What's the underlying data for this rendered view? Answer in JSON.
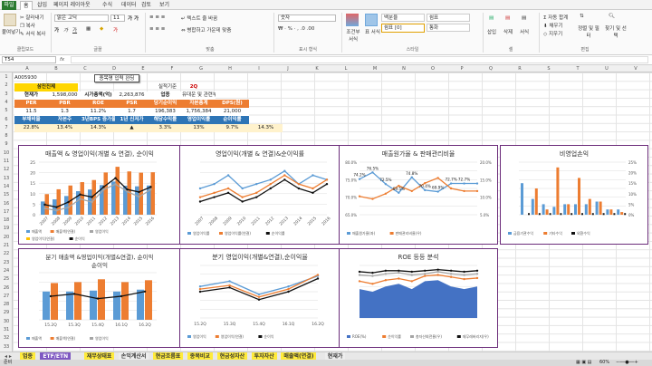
{
  "menu": {
    "file": "파일",
    "tabs": [
      "홈",
      "삽입",
      "페이지 레이아웃",
      "수식",
      "데이터",
      "검토",
      "보기"
    ]
  },
  "ribbon": {
    "paste": "붙여넣기",
    "cut": "잘라내기",
    "copy": "복사",
    "format_painter": "서식 복사",
    "font": "맑은 고딕",
    "font_size": "11",
    "wrap_text": "텍스트 줄 바꿈",
    "merge": "병합하고 가운데 맞춤",
    "number_format": "숫자",
    "style_bad": "백분율",
    "style_good": "쉼표",
    "style_sel": "쉼표 [0]",
    "style_currency": "통화",
    "cond_format": "조건부 서식",
    "table_format": "표 서식",
    "cell_style": "셀 스타일",
    "insert": "삽입",
    "delete": "삭제",
    "format": "서식",
    "autosum": "자동 합계",
    "fill": "채우기",
    "clear": "지우기",
    "sort": "정렬 및 필터",
    "find": "찾기 및 선택",
    "groups": [
      "클립보드",
      "글꼴",
      "맞춤",
      "표시 형식",
      "스타일",
      "셀",
      "편집"
    ]
  },
  "formula_bar": {
    "name_box": "T54",
    "fx": "fx",
    "content": ""
  },
  "columns": [
    "A",
    "B",
    "C",
    "D",
    "E",
    "F",
    "G",
    "H",
    "I",
    "J",
    "K",
    "L",
    "M",
    "N",
    "O",
    "P",
    "Q",
    "R",
    "S",
    "T",
    "U",
    "V"
  ],
  "rows": [
    "1",
    "2",
    "3",
    "4",
    "5",
    "6",
    "7",
    "8",
    "9",
    "10",
    "11",
    "12",
    "13",
    "14",
    "15",
    "16",
    "17",
    "18",
    "19",
    "20",
    "21",
    "22",
    "23",
    "24",
    "25",
    "26",
    "27",
    "28",
    "29",
    "30",
    "31",
    "32",
    "33"
  ],
  "sheet": {
    "code": "A005930",
    "button": "종목명 입력 완딩",
    "company": "삼진진제",
    "period_label": "실적기준",
    "period": "2Q",
    "row3": [
      "현재가",
      "1,598,000",
      "시가총액(억)",
      "2,263,876",
      "업종",
      "유대운 및 관련부품"
    ],
    "row4": [
      "PER",
      "PBR",
      "ROE",
      "PSR",
      "당기순이익",
      "자본총계",
      "DPS(원)"
    ],
    "row5": [
      "11.5",
      "1.3",
      "11.2%",
      "1.7",
      "196,383",
      "1,756,384",
      "21,000"
    ],
    "row6": [
      "부채비율",
      "자본주",
      "3년BPS 증가율",
      "1년 신저가",
      "해당수익률",
      "영업이익률",
      "순이익률"
    ],
    "row7": [
      "22.8%",
      "13.4%",
      "14.3%",
      "▲",
      "3.3%",
      "13%",
      "9.7%",
      "14.3%"
    ]
  },
  "charts": {
    "c1": {
      "title": "매출액 & 영업이익(개별 & 연결), 순이익",
      "legend": [
        "매출액",
        "매출액(연결)",
        "영업이익",
        "영업이익(연결)",
        "순이익"
      ]
    },
    "c2": {
      "title": "영업이익(개별 & 연결)&순이익률",
      "legend": [
        "영업이익률",
        "영업이익률(연결)",
        "순이익률"
      ]
    },
    "c3": {
      "title": "매출원가율 & 판매관리비율",
      "legend": [
        "매출원가율(좌)",
        "판매관리비율(우)"
      ],
      "labels": [
        "74.2%",
        "76.5%",
        "72.5%",
        "69.5%",
        "74.8%",
        "70.4%",
        "69.9%",
        "72.7%",
        "72.7%"
      ]
    },
    "c4": {
      "title": "비영업손익",
      "legend": [
        "금융기관수익",
        "기타수익",
        "외환수익"
      ]
    },
    "c5": {
      "title": "분기 매출액 &영업이익(개별&연결), 순이익",
      "legend": [
        "매출액",
        "매출액(연결)",
        "영업이익"
      ]
    },
    "c6": {
      "title": "분기 영업이익(개별&연결),순이익율",
      "legend": [
        "영업이익",
        "영업이익(연결)",
        "순이익"
      ]
    },
    "c7": {
      "title": "ROE 등등 분석",
      "legend": [
        "ROE(%)",
        "순이익률",
        "총자산회전율(우)",
        "재무레버리지(우)"
      ]
    }
  },
  "chart_data": [
    {
      "type": "bar",
      "title": "매출액 & 영업이익(개별 & 연결), 순이익",
      "categories": [
        "2007",
        "2008",
        "2009",
        "2010",
        "2011",
        "2012",
        "2013",
        "2014",
        "2015",
        "2016"
      ],
      "series": [
        {
          "name": "매출액",
          "values": [
            6.3,
            7.3,
            8.9,
            11.2,
            12.0,
            14.1,
            15.8,
            13.8,
            13.5,
            13.9
          ]
        },
        {
          "name": "매출액(연결)",
          "values": [
            9.8,
            12.1,
            13.9,
            15.5,
            16.5,
            20.1,
            22.8,
            20.6,
            20.0,
            20.2
          ]
        },
        {
          "name": "영업이익",
          "values": [
            0.6,
            0.4,
            0.7,
            1.5,
            1.2,
            2.4,
            2.9,
            2.2,
            1.7,
            2.4
          ]
        },
        {
          "name": "순이익",
          "values": [
            0.8,
            0.6,
            1.0,
            1.6,
            1.4,
            2.2,
            2.9,
            2.0,
            1.8,
            2.2
          ]
        }
      ],
      "ylim": [
        0,
        25
      ]
    },
    {
      "type": "line",
      "title": "매출원가율 & 판매관리비율",
      "categories": [
        "2007",
        "2008",
        "2009",
        "2010",
        "2011",
        "2012",
        "2013",
        "2014",
        "2015",
        "2016"
      ],
      "series": [
        {
          "name": "매출원가율(좌)",
          "values": [
            74.2,
            76.5,
            72.5,
            69.5,
            74.8,
            70.4,
            69.9,
            72.7,
            72.7,
            72.7
          ]
        }
      ],
      "ylim": [
        62,
        80
      ]
    }
  ],
  "sheet_tabs": [
    "업종",
    "ETF/ETN",
    "재무상태표",
    "손익계산서",
    "현금흐름표",
    "종목비교",
    "현금성자산",
    "투자자산",
    "매출액(연결)",
    "현재가"
  ],
  "status": {
    "ready": "준비",
    "zoom": "60%"
  }
}
